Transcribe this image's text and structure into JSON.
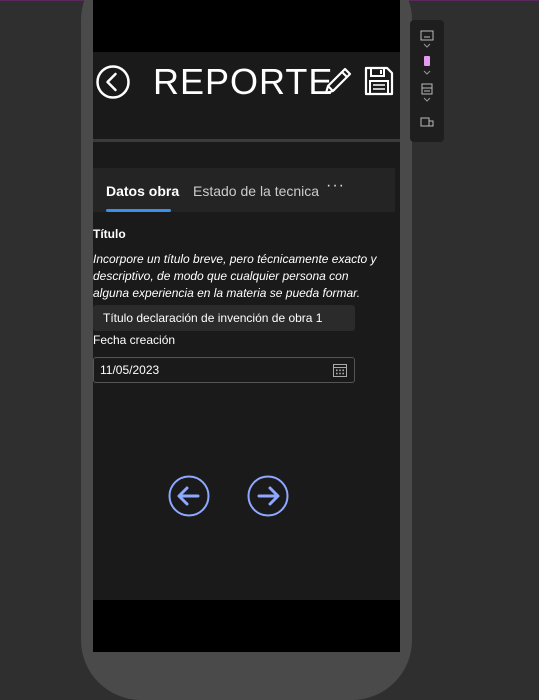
{
  "app": {
    "title": "REPORTE"
  },
  "tabs": [
    {
      "label": "Datos obra",
      "selected": true
    },
    {
      "label": "Estado de la tecnica",
      "selected": false
    },
    {
      "label": "···"
    }
  ],
  "form": {
    "title_label": "Título",
    "title_help": "Incorpore un título breve, pero técnicamente exacto y descriptivo, de modo que cualquier persona con alguna experiencia en la materia se pueda formar.",
    "title_value": "Título declaración de invención de obra 1",
    "date_label": "Fecha creación",
    "date_value": "11/05/2023"
  },
  "icons": {
    "back": "arrow-left-circle-icon",
    "edit": "pencil-icon",
    "save": "floppy-disk-icon",
    "calendar": "calendar-icon",
    "prev": "arrow-left-circle-icon",
    "next": "arrow-right-circle-icon"
  },
  "colors": {
    "accent": "#3b8eea",
    "nav_circle": "#8fa8ff",
    "background": "#1a1a1a",
    "tab_bar": "#242424",
    "pink": "#e39bf0"
  }
}
